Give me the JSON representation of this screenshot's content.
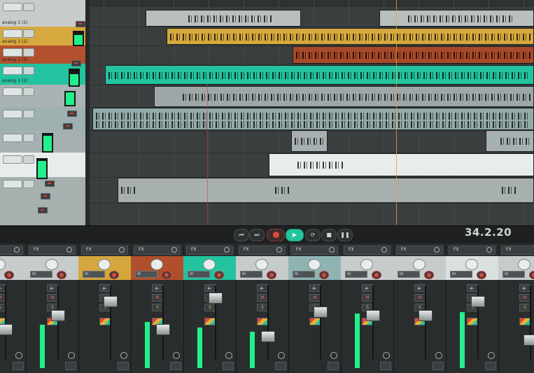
{
  "transport": {
    "buttons": [
      "go-to-start",
      "go-to-end",
      "record",
      "play",
      "repeat",
      "stop",
      "pause"
    ],
    "time": "34.2.20"
  },
  "tracks": [
    {
      "name": "analog 1 (2)",
      "color": "#c9cccc"
    },
    {
      "name": "analog 1 (2)",
      "color": "#d6a93e"
    },
    {
      "name": "analog 1 (2)",
      "color": "#b4502e"
    },
    {
      "name": "analog 1 (2)",
      "color": "#23c39f"
    },
    {
      "name": "",
      "color": "#a9b3b3"
    },
    {
      "name": "",
      "color": "#9fb0b0"
    },
    {
      "name": "",
      "color": "#a7b0b0"
    },
    {
      "name": "",
      "color": "#e9ecec"
    },
    {
      "name": "",
      "color": "#a7afaf"
    }
  ],
  "mixer": {
    "fx_label": "FX",
    "input_label": "In",
    "mute_label": "M",
    "solo_label": "S",
    "channel_colors": [
      "#c6cbcb",
      "#c6cbcb",
      "#d4a63c",
      "#b14f2c",
      "#23c39f",
      "#c6cbcb",
      "#8fb3b3",
      "#c6cbcb",
      "#c6cbcb",
      "#dadfdf",
      "#c6cbcb"
    ]
  }
}
